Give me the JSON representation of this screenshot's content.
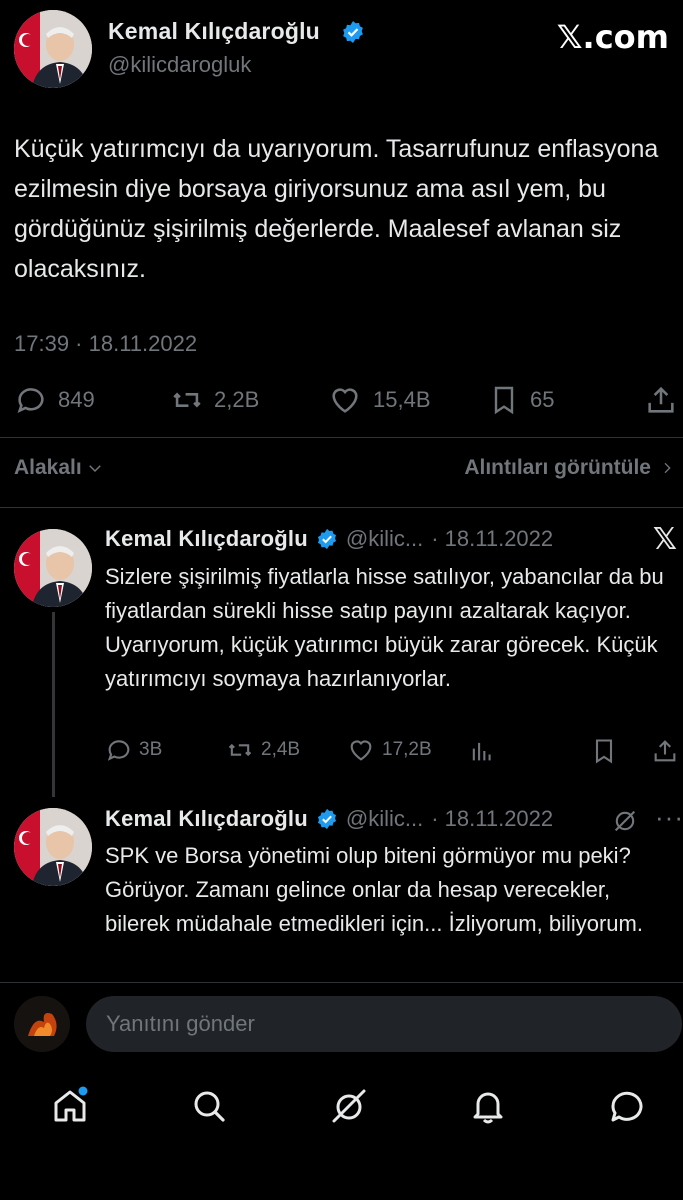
{
  "main_tweet": {
    "author_name": "Kemal Kılıçdaroğlu",
    "handle": "@kilicdarogluk",
    "text": "Küçük yatırımcıyı da uyarıyorum. Tasarrufunuz enflasyona ezilmesin diye borsaya giriyorsunuz ama asıl yem, bu gördüğünüz şişirilmiş değerlerde. Maalesef avlanan siz olacaksınız.",
    "timestamp": "17:39 · 18.11.2022",
    "stats": {
      "replies": "849",
      "reposts": "2,2B",
      "likes": "15,4B",
      "bookmarks": "65"
    }
  },
  "brand": "𝕏.com",
  "related_bar": {
    "left_label": "Alakalı",
    "right_label": "Alıntıları görüntüle"
  },
  "replies": [
    {
      "author_name": "Kemal Kılıçdaroğlu",
      "handle": "@kilic...",
      "date": "· 18.11.2022",
      "text": "Sizlere şişirilmiş fiyatlarla hisse satılıyor, yabancılar da bu fiyatlardan sürekli hisse satıp payını azaltarak kaçıyor. Uyarıyorum, küçük yatırımcı büyük zarar görecek. Küçük yatırımcıyı soymaya hazırlanıyorlar.",
      "stats": {
        "replies": "3B",
        "reposts": "2,4B",
        "likes": "17,2B"
      }
    },
    {
      "author_name": "Kemal Kılıçdaroğlu",
      "handle": "@kilic...",
      "date": "· 18.11.2022",
      "text": "SPK ve Borsa yönetimi olup biteni görmüyor mu peki? Görüyor. Zamanı gelince onlar da hesap verecekler, bilerek müdahale etmedikleri için... İzliyorum, biliyorum."
    }
  ],
  "composer": {
    "placeholder": "Yanıtını gönder"
  },
  "bottom_nav": [
    "home-icon",
    "search-icon",
    "grok-icon",
    "notifications-icon",
    "messages-icon"
  ],
  "colors": {
    "verified": "#1d9bf0",
    "background": "#000000",
    "muted": "#71767b"
  }
}
